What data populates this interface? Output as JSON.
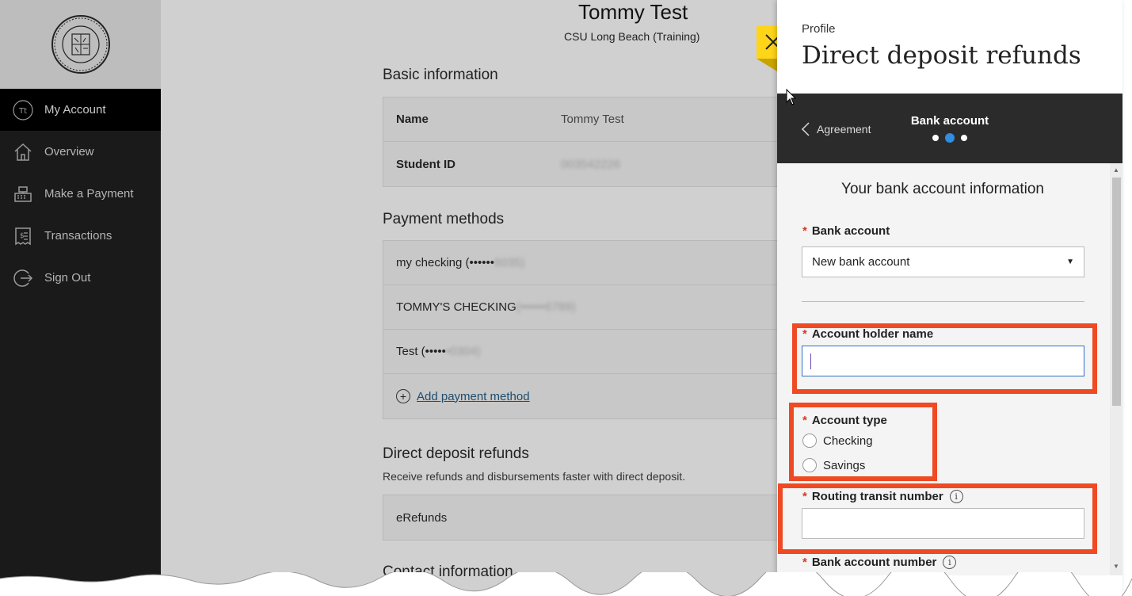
{
  "sidebar": {
    "items": [
      {
        "label": "My Account",
        "icon": "initials-avatar-icon",
        "initials": "Tt",
        "active": true
      },
      {
        "label": "Overview",
        "icon": "home-icon"
      },
      {
        "label": "Make a Payment",
        "icon": "cash-register-icon"
      },
      {
        "label": "Transactions",
        "icon": "receipt-icon"
      },
      {
        "label": "Sign Out",
        "icon": "sign-out-icon"
      }
    ]
  },
  "main": {
    "user_name": "Tommy Test",
    "school": "CSU Long Beach (Training)",
    "basic_info": {
      "title": "Basic information",
      "rows": [
        {
          "label": "Name",
          "value": "Tommy Test"
        },
        {
          "label": "Student ID",
          "value": "003542226"
        }
      ]
    },
    "payment_methods": {
      "title": "Payment methods",
      "items": [
        {
          "text": "my checking (••••••",
          "masked": "6035)"
        },
        {
          "text": "TOMMY'S CHECKING",
          "masked": " (••••••6789)"
        },
        {
          "text": "Test (•••••",
          "masked": "•0304)"
        }
      ],
      "add_label": "Add payment method"
    },
    "direct_deposit": {
      "title": "Direct deposit refunds",
      "subtitle": "Receive refunds and disbursements faster with direct deposit.",
      "item": "eRefunds"
    },
    "contact": {
      "title": "Contact information"
    }
  },
  "panel": {
    "kicker": "Profile",
    "title": "Direct deposit refunds",
    "wizard": {
      "back_label": "Agreement",
      "step_label": "Bank account",
      "steps_total": 3,
      "current_step": 2
    },
    "form": {
      "heading": "Your bank account information",
      "required_mark": "*",
      "bank_account_label": "Bank account",
      "bank_account_value": "New bank account",
      "holder_label": "Account holder name",
      "holder_value": "",
      "type_label": "Account type",
      "type_options": [
        "Checking",
        "Savings"
      ],
      "routing_label": "Routing transit number",
      "routing_value": "",
      "bank_number_label": "Bank account number"
    }
  },
  "colors": {
    "highlight": "#ef4a24",
    "close_button": "#ffd51a",
    "active_dot": "#2f8ee0",
    "required": "#d13a26"
  }
}
